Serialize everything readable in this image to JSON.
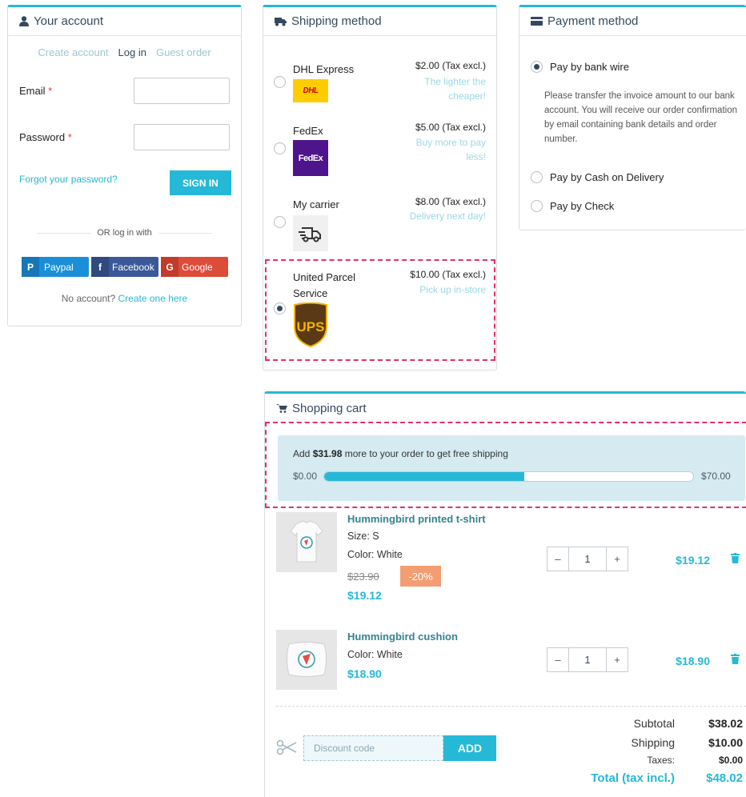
{
  "account": {
    "title": "Your account",
    "tabs": [
      "Create account",
      "Log in",
      "Guest order"
    ],
    "email_label": "Email",
    "password_label": "Password",
    "required_mark": "*",
    "forgot": "Forgot your password?",
    "sign_in": "SIGN IN",
    "or_text": "OR log in with",
    "social": [
      {
        "label": "Paypal",
        "color": "#1a8fd8"
      },
      {
        "label": "Facebook",
        "color": "#3b5998"
      },
      {
        "label": "Google",
        "color": "#dd4b39"
      }
    ],
    "no_account": "No account?",
    "create_link": "Create one here"
  },
  "shipping": {
    "title": "Shipping method",
    "carriers": [
      {
        "name": "DHL Express",
        "price": "$2.00 (Tax excl.)",
        "delay": "The lighter the cheaper!",
        "logo": "DHL",
        "selected": false
      },
      {
        "name": "FedEx",
        "price": "$5.00 (Tax excl.)",
        "delay": "Buy more to pay less!",
        "logo": "FedEx",
        "selected": false
      },
      {
        "name": "My carrier",
        "price": "$8.00 (Tax excl.)",
        "delay": "Delivery next day!",
        "logo": "truck-icon",
        "selected": false
      },
      {
        "name": "United Parcel Service",
        "price": "$10.00 (Tax excl.)",
        "delay": "Pick up in-store",
        "logo": "UPS",
        "selected": true
      }
    ]
  },
  "payment": {
    "title": "Payment method",
    "options": [
      {
        "label": "Pay by bank wire",
        "selected": true
      },
      {
        "label": "Pay by Cash on Delivery",
        "selected": false
      },
      {
        "label": "Pay by Check",
        "selected": false
      }
    ],
    "bank_wire_desc": "Please transfer the invoice amount to our bank account. You will receive our order confirmation by email containing bank details and order number."
  },
  "cart": {
    "title": "Shopping cart",
    "free_shipping": {
      "prefix": "Add",
      "amount": "$31.98",
      "suffix": "more to your order to get free shipping",
      "min_label": "$0.00",
      "max_label": "$70.00",
      "progress": 0.543
    },
    "items": [
      {
        "name": "Hummingbird printed t-shirt",
        "size": "Size: S",
        "color": "Color: White",
        "regular_price": "$23.90",
        "discount": "-20%",
        "price": "$19.12",
        "qty": "1",
        "total": "$19.12"
      },
      {
        "name": "Hummingbird cushion",
        "color": "Color: White",
        "price": "$18.90",
        "qty": "1",
        "total": "$18.90"
      }
    ],
    "qty_minus": "–",
    "qty_plus": "+",
    "discount_placeholder": "Discount code",
    "add_label": "ADD",
    "summary": {
      "subtotal_label": "Subtotal",
      "subtotal": "$38.02",
      "shipping_label": "Shipping",
      "shipping": "$10.00",
      "taxes_label": "Taxes:",
      "taxes": "$0.00",
      "total_label": "Total (tax incl.)",
      "total": "$48.02"
    }
  },
  "colors": {
    "accent": "#25b9d7",
    "highlight": "#e0306a",
    "badge": "#f39d72",
    "heading": "#34495e"
  }
}
